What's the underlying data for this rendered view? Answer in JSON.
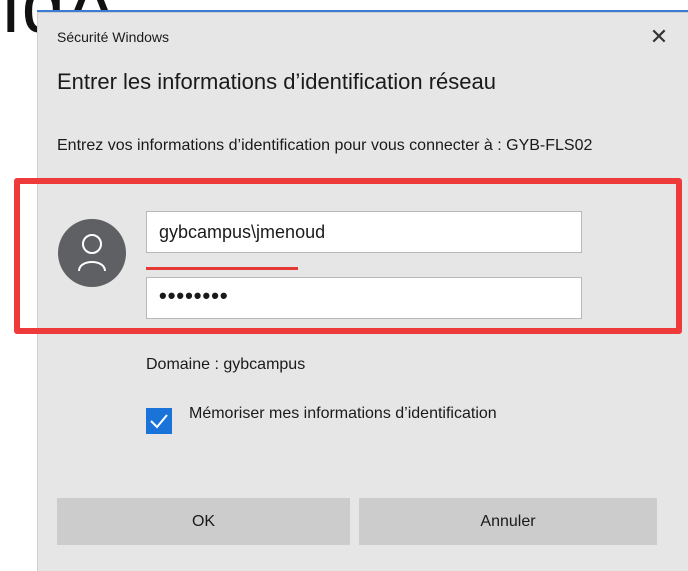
{
  "background": {
    "fragment_text": "ıdA"
  },
  "dialog": {
    "window_title": "Sécurité Windows",
    "close_glyph": "✕",
    "heading": "Entrer les informations d’identification réseau",
    "subtitle": "Entrez vos informations d’identification pour vous connecter à : GYB-FLS02",
    "username_value": "gybcampus\\jmenoud",
    "password_mask": "••••••••",
    "domain_text": "Domaine : gybcampus",
    "remember_label": "Mémoriser mes informations d’identification",
    "remember_checked": true,
    "ok_label": "OK",
    "cancel_label": "Annuler"
  },
  "colors": {
    "accent_blue": "#1a73d9",
    "highlight_red": "#ee3a3a",
    "dialog_bg": "#e6e6e6"
  },
  "icons": {
    "avatar": "user-avatar-icon",
    "check": "checkmark-icon",
    "close": "close-icon"
  }
}
